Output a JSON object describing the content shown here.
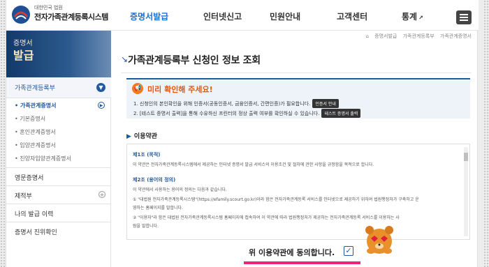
{
  "header": {
    "logo_sub": "대한민국 법원",
    "logo_main": "전자가족관계등록시스템",
    "nav": [
      "증명서발급",
      "인터넷신고",
      "민원안내",
      "고객센터",
      "통계"
    ]
  },
  "sidebar": {
    "banner_title": "증명서",
    "banner_title2": "발급",
    "selected_group": "가족관계등록부",
    "sub_items": [
      "가족관계증명서",
      "기본증명서",
      "혼인관계증명서",
      "입양관계증명서",
      "친양자입양관계증명서"
    ],
    "groups": [
      "영문증명서",
      "제적부",
      "나의 발급 이력",
      "증명서 진위확인"
    ]
  },
  "breadcrumb": [
    "증명서발급",
    "가족관계등록부",
    "가족관계증명서"
  ],
  "main": {
    "title": "가족관계등록부 신청인 정보 조회",
    "notice_title": "미리 확인해 주세요!",
    "notice_line1": "1. 신청인의 본인확인을 위해 인증서(공동인증서, 금융인증서, 간편인증)가 필요합니다.",
    "notice_btn1": "인증서 안내",
    "notice_line2": "2. [테스트 증명서 출력]을 통해 수유하신 프린터의 정상 출력 여부를 확인하실 수 있습니다.",
    "notice_btn2": "테스트 증명서 출력",
    "terms_heading": "이용약관",
    "terms": {
      "h1": "제1조 (목적)",
      "p1": "이 약관은 전자가족관계등록시스템에서 제공하는 인터넷 증명서 발급 서비스의 이용조건 및 절차에 관한 사항을 규정함을 목적으로 합니다.",
      "h2": "제2조 (용어의 정의)",
      "p2": "이 약관에서 사용하는 용어의 정의는 다음과 같습니다.",
      "p3": "① \"대법원 전자가족관계등록시스템\"(https://efamily.scourt.go.kr)이라 함은 전자가족관계등록 서비스를 인터넷으로 제공하기 위하여 법원행정처가 구축하고 운",
      "p4": "영하는 홈페이지를 말합니다.",
      "p5": "② \"이용자\"라 함은 대법원 전자가족관계등록시스템 홈페이지에 접속하여 이 약관에 따라 법원행정처가 제공하는 전자가족관계등록 서비스를 이용하는 사",
      "p6": "람을 말합니다."
    },
    "agree_text": "위 이용약관에 동의합니다.",
    "agree_checked": "✓"
  },
  "colors": {
    "accent": "#1f5aa0",
    "highlight": "#e8247c",
    "notice_orange": "#e05a12"
  }
}
